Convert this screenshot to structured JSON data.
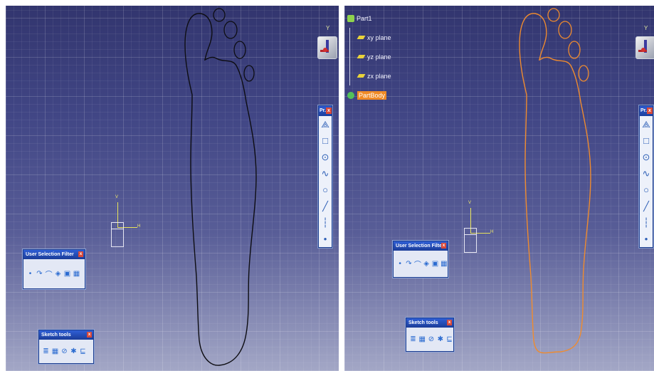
{
  "left_panel": {
    "palette_toolbar": {
      "title": "Pr...",
      "close": "x",
      "tools": [
        {
          "name": "profile-tool",
          "glyph": "⟁"
        },
        {
          "name": "rectangle-tool",
          "glyph": "□"
        },
        {
          "name": "circle-tool",
          "glyph": "⊙"
        },
        {
          "name": "spline-tool",
          "glyph": "∿"
        },
        {
          "name": "conic-tool",
          "glyph": "○"
        },
        {
          "name": "line-tool",
          "glyph": "╱"
        },
        {
          "name": "axis-tool",
          "glyph": "┆"
        },
        {
          "name": "point-tool",
          "glyph": "•"
        }
      ]
    },
    "selection_filter": {
      "title": "User Selection Filter",
      "close": "x",
      "icons": [
        "•",
        "↷",
        "⌒",
        "◈",
        "▣",
        "▦"
      ]
    },
    "sketch_tools": {
      "title": "Sketch tools",
      "close": "x",
      "icons": [
        "≣",
        "▦",
        "⊘",
        "✱",
        "⊑"
      ]
    },
    "axis": {
      "v": "V",
      "h": "H"
    },
    "compass": {
      "axis": "Y"
    }
  },
  "right_panel": {
    "tree": {
      "root": "Part1",
      "children": [
        "xy plane",
        "yz plane",
        "zx plane",
        "PartBody"
      ],
      "selected": "PartBody"
    },
    "palette_toolbar": {
      "title": "Pr...",
      "close": "x",
      "tools": [
        {
          "name": "profile-tool",
          "glyph": "⟁"
        },
        {
          "name": "rectangle-tool",
          "glyph": "□"
        },
        {
          "name": "circle-tool",
          "glyph": "⊙"
        },
        {
          "name": "spline-tool",
          "glyph": "∿"
        },
        {
          "name": "conic-tool",
          "glyph": "○"
        },
        {
          "name": "line-tool",
          "glyph": "╱"
        },
        {
          "name": "axis-tool",
          "glyph": "┆"
        },
        {
          "name": "point-tool",
          "glyph": "•"
        }
      ]
    },
    "selection_filter": {
      "title": "User Selection Filter",
      "close": "x",
      "icons": [
        "•",
        "↷",
        "⌒",
        "◈",
        "▣",
        "▦"
      ]
    },
    "sketch_tools": {
      "title": "Sketch tools",
      "close": "x",
      "icons": [
        "≣",
        "▦",
        "⊘",
        "✱",
        "⊑"
      ]
    },
    "axis": {
      "v": "V",
      "h": "H"
    },
    "compass": {
      "axis": "Y"
    }
  },
  "colors": {
    "sketch_left": "#111111",
    "sketch_right": "#ee8a2c",
    "selection": "#f08a26"
  }
}
